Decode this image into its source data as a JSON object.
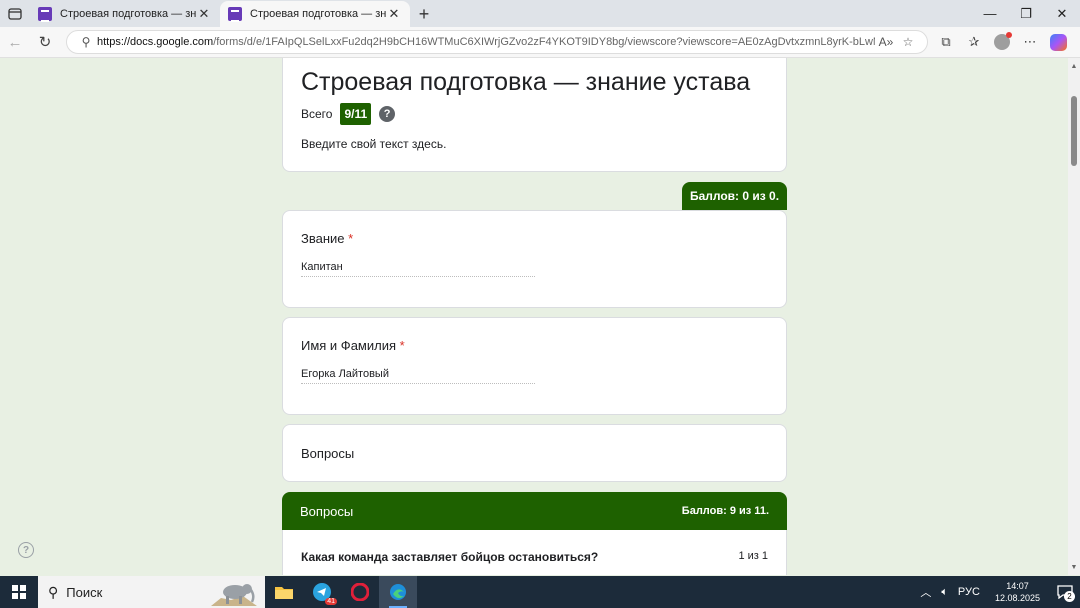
{
  "browser": {
    "tabs": [
      {
        "title": "Строевая подготовка — знание устава",
        "active": false
      },
      {
        "title": "Строевая подготовка — знание устава",
        "active": true
      }
    ],
    "url_domain": "https://docs.google.com",
    "url_rest": "/forms/d/e/1FAIpQLSelLxxFu2dq2H9bCH16WTMuC6XIWrjGZvo2zF4YKOT9IDY8bg/viewscore?viewscore=AE0zAgDvtxzmnL8yrK-bLwM...",
    "icons": {
      "back": "back-arrow-icon",
      "refresh": "refresh-icon",
      "site_info": "site-info-icon",
      "read_aloud": "read-aloud-icon",
      "favorite": "star-icon"
    }
  },
  "form": {
    "title": "Строевая подготовка — знание устава",
    "total_label": "Всего",
    "total_score": "9/11",
    "help_glyph": "?",
    "description": "Введите свой текст здесь.",
    "points_tab": "Баллов: 0 из 0.",
    "questions": [
      {
        "label": "Звание",
        "required_mark": "*",
        "answer": "Капитан"
      },
      {
        "label": "Имя и Фамилия",
        "required_mark": "*",
        "answer": "Егорка Лайтовый"
      }
    ],
    "section_card_title": "Вопросы",
    "section": {
      "title": "Вопросы",
      "score": "Баллов: 9 из 11.",
      "first_question": "Какая команда заставляет бойцов остановиться?",
      "first_question_score": "1 из 1"
    },
    "accent_color": "#1e6100"
  },
  "taskbar": {
    "search_label": "Поиск",
    "language": "РУС",
    "time": "14:07",
    "date": "12.08.2025",
    "notification_count": "2",
    "telegram_badge": "41"
  }
}
